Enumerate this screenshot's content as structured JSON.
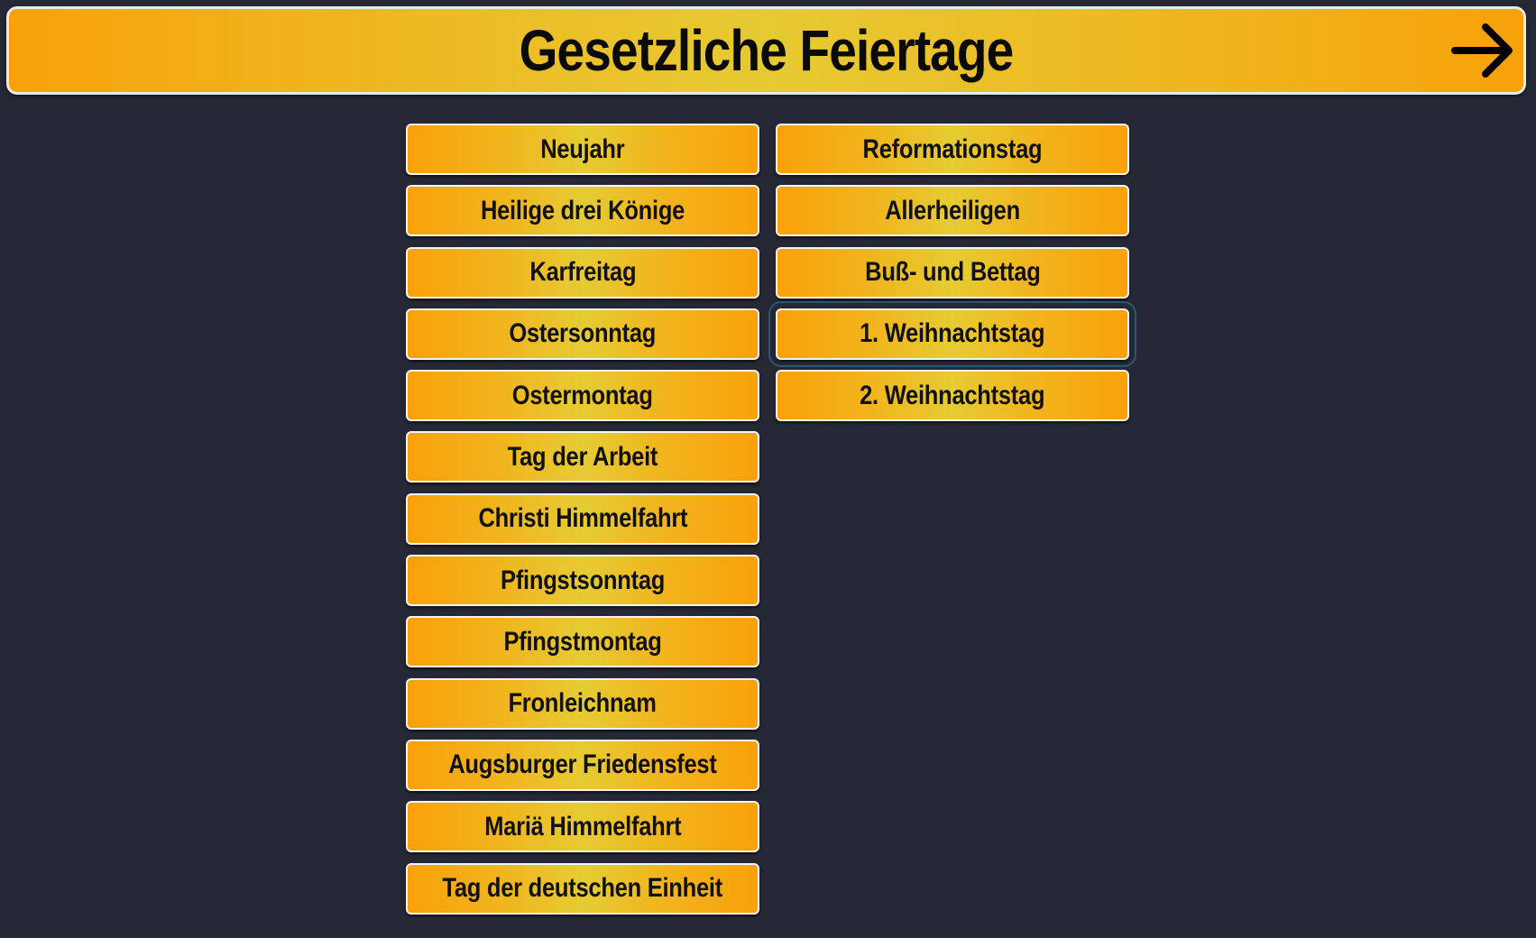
{
  "header": {
    "title": "Gesetzliche Feiertage",
    "next_icon": "arrow-right-icon"
  },
  "holidays_left": [
    {
      "label": "Neujahr"
    },
    {
      "label": "Heilige drei Könige"
    },
    {
      "label": "Karfreitag"
    },
    {
      "label": "Ostersonntag"
    },
    {
      "label": "Ostermontag"
    },
    {
      "label": "Tag der Arbeit"
    },
    {
      "label": "Christi Himmelfahrt"
    },
    {
      "label": "Pfingstsonntag"
    },
    {
      "label": "Pfingstmontag"
    },
    {
      "label": "Fronleichnam"
    },
    {
      "label": "Augsburger Friedensfest"
    },
    {
      "label": "Mariä Himmelfahrt"
    },
    {
      "label": "Tag der deutschen Einheit"
    }
  ],
  "holidays_right": [
    {
      "label": "Reformationstag"
    },
    {
      "label": "Allerheiligen"
    },
    {
      "label": "Buß- und Bettag"
    },
    {
      "label": "1. Weihnachtstag",
      "selected": true
    },
    {
      "label": "2. Weihnachtstag"
    }
  ],
  "colors": {
    "background": "#262935",
    "button_orange": "#f9a10a",
    "button_yellow": "#e6cb33",
    "focus_outline": "#2c5670"
  }
}
